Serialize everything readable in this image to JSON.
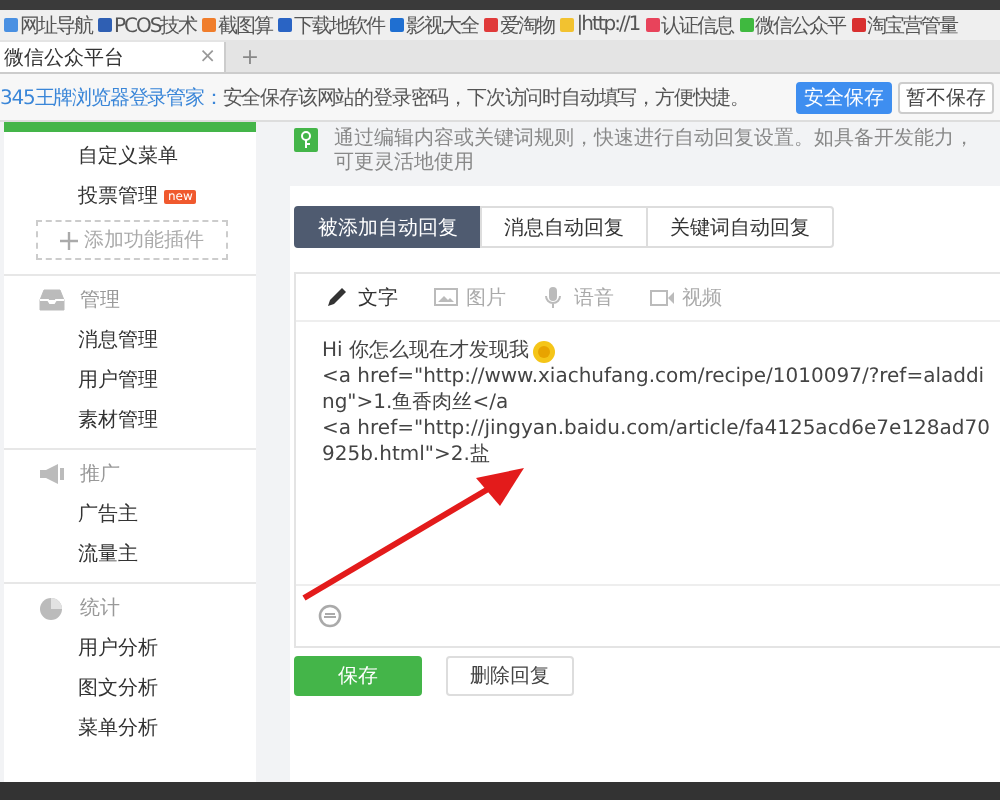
{
  "bookmarks": [
    {
      "label": "网址导航",
      "color": "#4a90e2"
    },
    {
      "label": "PCOS技术",
      "color": "#2f5fb3"
    },
    {
      "label": "截图算",
      "color": "#f07d2b"
    },
    {
      "label": "下载地软件",
      "color": "#2a64c4"
    },
    {
      "label": "影视大全",
      "color": "#1f6fd1"
    },
    {
      "label": "爱淘物",
      "color": "#e03a3a"
    },
    {
      "label": "|http://1",
      "color": "#f2c230"
    },
    {
      "label": "认证信息",
      "color": "#e8435b"
    },
    {
      "label": "微信公众平",
      "color": "#3fb93f"
    },
    {
      "label": "淘宝营管量",
      "color": "#d93030"
    }
  ],
  "browser_tab": {
    "title": "微信公众平台",
    "close": "×",
    "new_tab": "+"
  },
  "password_bar": {
    "brand": "345王牌浏览器登录管家：",
    "message": "安全保存该网站的登录密码，下次访问时自动填写，方便快捷。",
    "buttons": [
      {
        "label": "安全保存",
        "kind": "primary"
      },
      {
        "label": "暂不保存",
        "kind": "default"
      }
    ]
  },
  "sidebar": {
    "sections": [
      {
        "items": [
          {
            "label": "自定义菜单"
          },
          {
            "label": "投票管理",
            "badge": "new"
          }
        ],
        "plugin": "添加功能插件"
      },
      {
        "title": "管理",
        "items": [
          {
            "label": "消息管理"
          },
          {
            "label": "用户管理"
          },
          {
            "label": "素材管理"
          }
        ]
      },
      {
        "title": "推广",
        "items": [
          {
            "label": "广告主"
          },
          {
            "label": "流量主"
          }
        ]
      },
      {
        "title": "统计",
        "items": [
          {
            "label": "用户分析"
          },
          {
            "label": "图文分析"
          },
          {
            "label": "菜单分析"
          }
        ]
      }
    ]
  },
  "notice": "通过编辑内容或关键词规则，快速进行自动回复设置。如具备开发能力，可更灵活地使用",
  "reply_tabs": [
    {
      "label": "被添加自动回复",
      "selected": true
    },
    {
      "label": "消息自动回复",
      "selected": false
    },
    {
      "label": "关键词自动回复",
      "selected": false
    }
  ],
  "editor": {
    "tools": [
      {
        "label": "文字",
        "selected": true
      },
      {
        "label": "图片",
        "selected": false
      },
      {
        "label": "语音",
        "selected": false
      },
      {
        "label": "视频",
        "selected": false
      }
    ],
    "lines": [
      "Hi 你怎么现在才发现我",
      "<a href=\"http://www.xiachufang.com/recipe/1010097/?ref=aladding\">1.鱼香肉丝</a",
      "<a href=\"http://jingyan.baidu.com/article/fa4125acd6e7e128ad70925b.html\">2.盐"
    ]
  },
  "actions": [
    {
      "label": "保存",
      "kind": "primary"
    },
    {
      "label": "删除回复",
      "kind": "default"
    }
  ]
}
